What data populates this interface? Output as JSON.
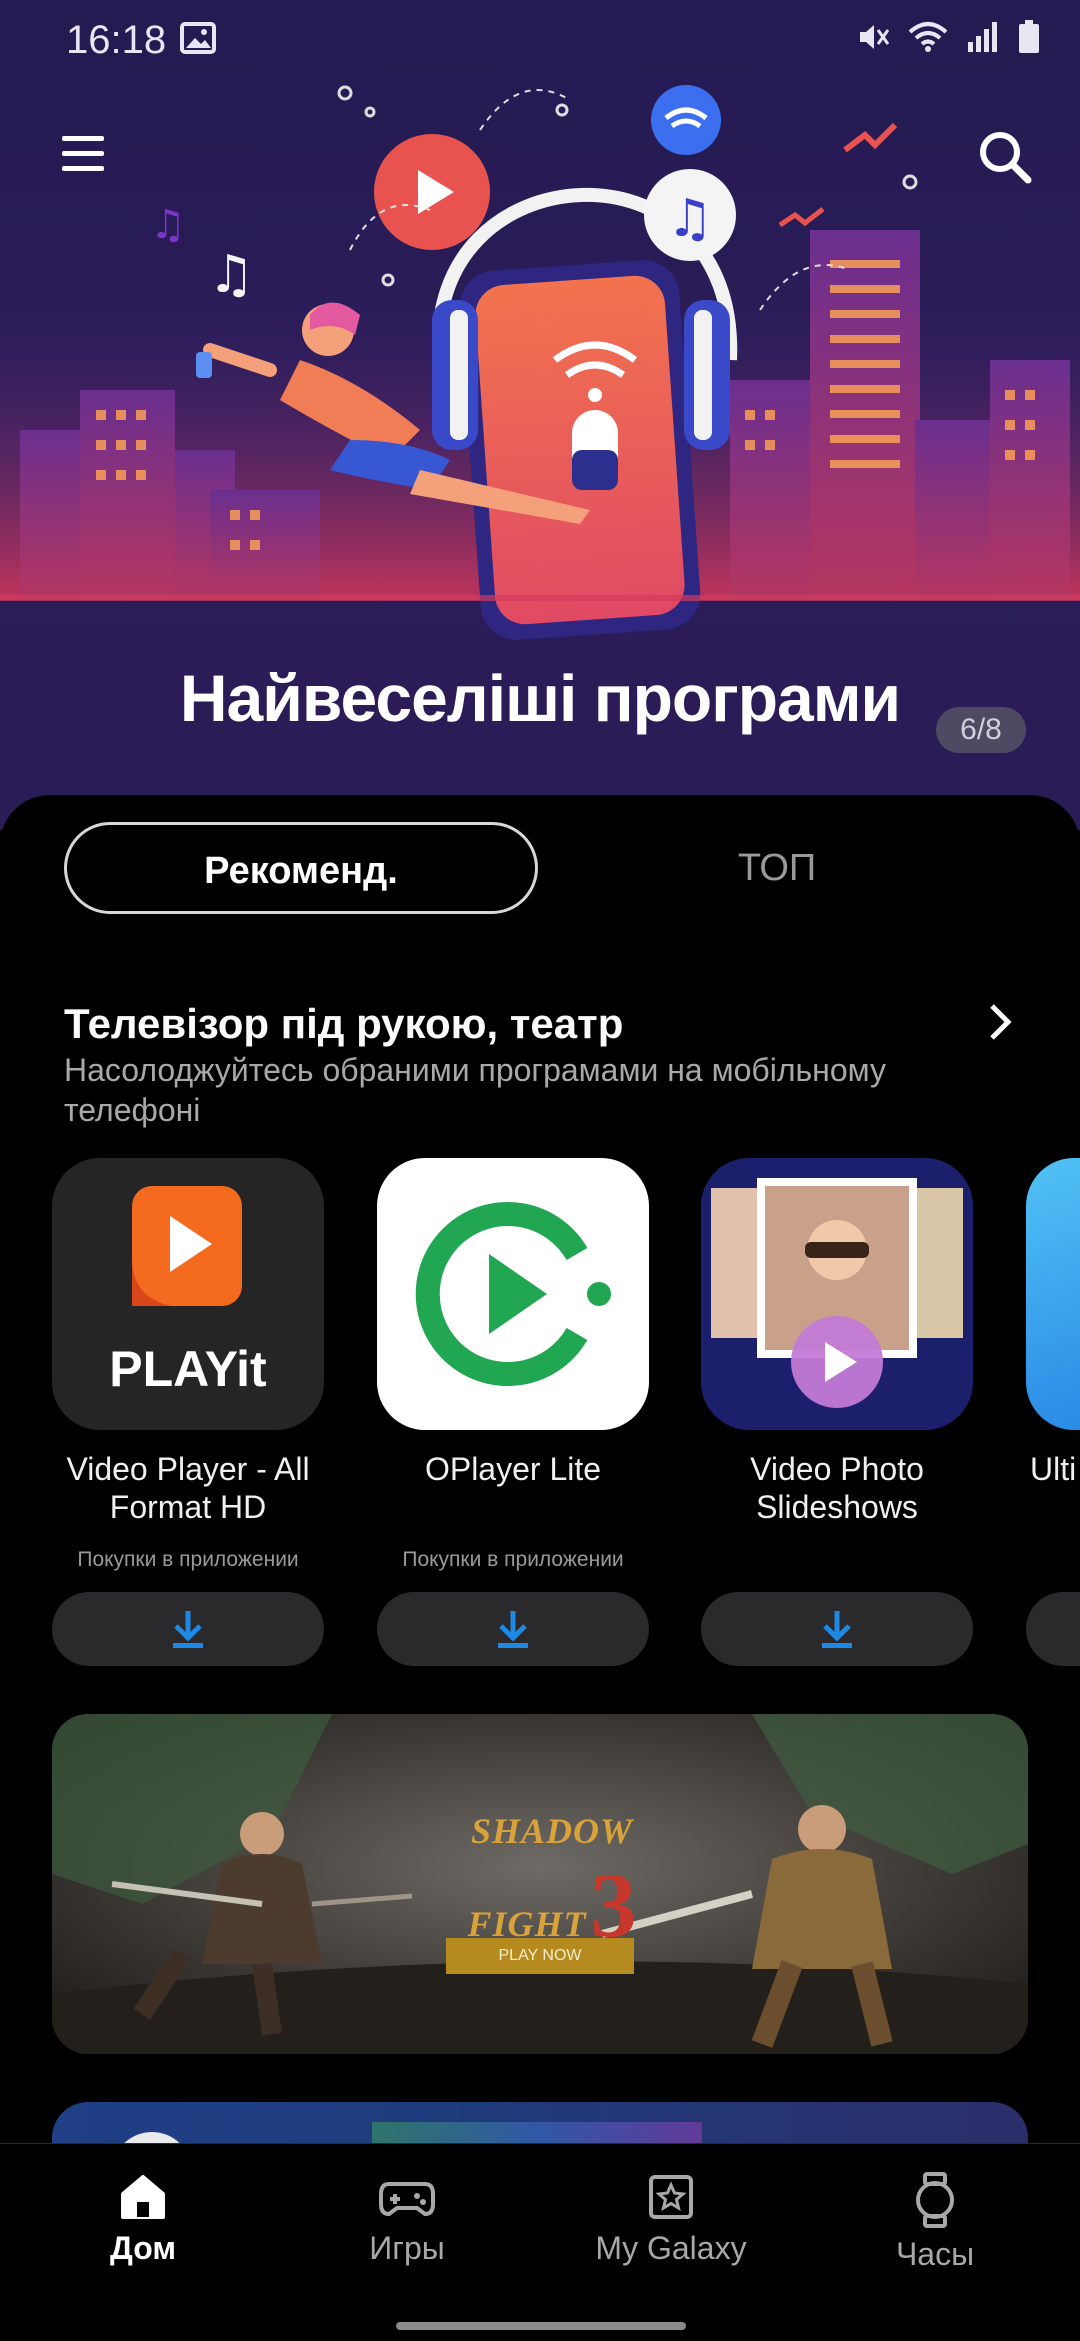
{
  "status_bar": {
    "time": "16:18"
  },
  "hero": {
    "title": "Найвеселіші програми",
    "counter": "6/8"
  },
  "tabs": [
    {
      "label": "Рекоменд.",
      "selected": true
    },
    {
      "label": "ТОП",
      "selected": false
    }
  ],
  "section": {
    "title": "Телевізор під рукою, театр",
    "subtitle": "Насолоджуйтесь обраними програмами на мобільному телефоні"
  },
  "apps": [
    {
      "name": "Video Player - All Format HD Video…",
      "meta": "Покупки в приложении",
      "icon_text": "PLAYit"
    },
    {
      "name": "OPlayer Lite",
      "meta": "Покупки в приложении"
    },
    {
      "name": "Video Photo Slideshows",
      "meta": ""
    },
    {
      "name": "Ulti Play",
      "meta": ""
    }
  ],
  "banner": {
    "game_title": "SHADOW FIGHT",
    "game_number": "3",
    "cta": "PLAY NOW"
  },
  "bottom_nav": [
    {
      "label": "Дом",
      "icon": "home-icon",
      "active": true
    },
    {
      "label": "Игры",
      "icon": "gamepad-icon",
      "active": false
    },
    {
      "label": "My Galaxy",
      "icon": "star-icon",
      "active": false
    },
    {
      "label": "Часы",
      "icon": "watch-icon",
      "active": false
    }
  ],
  "colors": {
    "accent_download": "#1e88e5",
    "hero_bg": "#2a1c55"
  }
}
